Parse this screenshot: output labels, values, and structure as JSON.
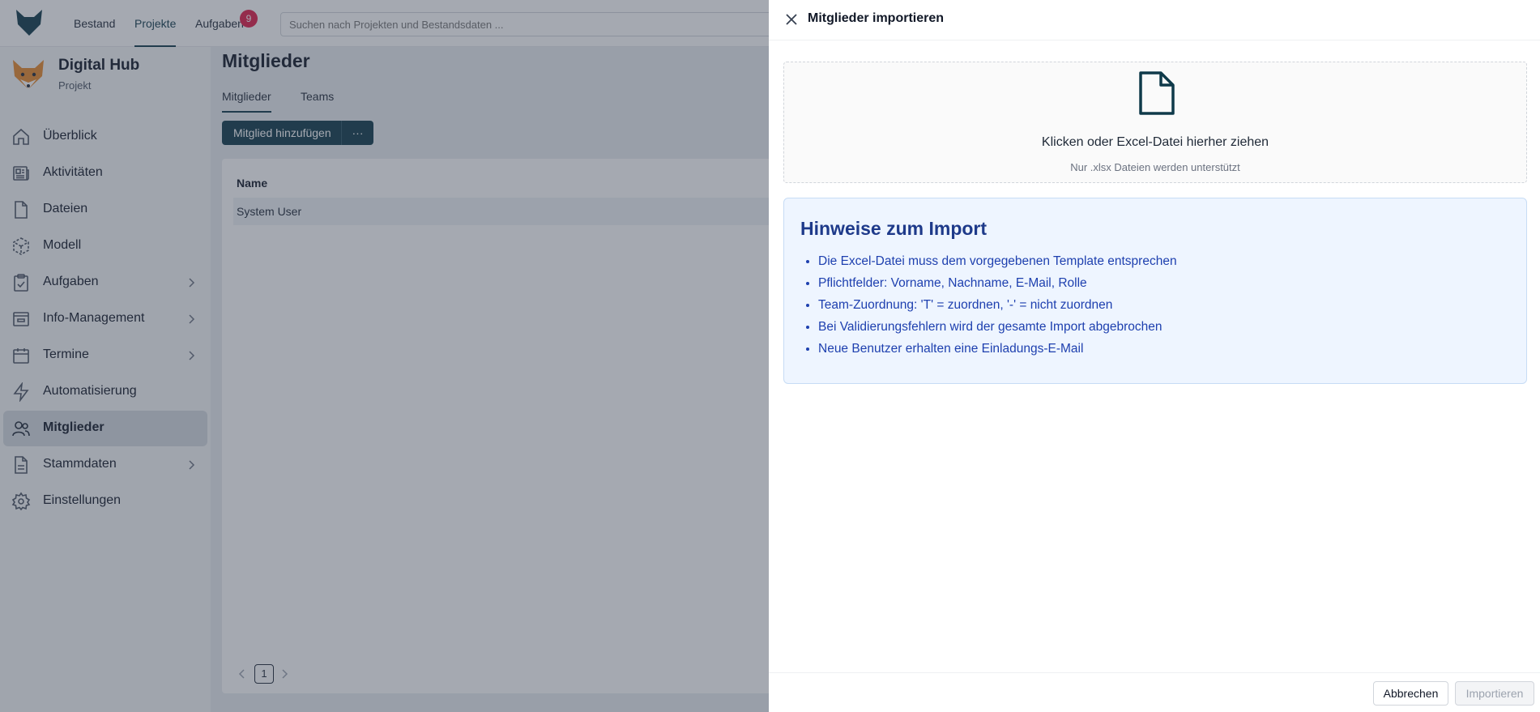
{
  "topnav": {
    "items": [
      {
        "label": "Bestand"
      },
      {
        "label": "Projekte"
      },
      {
        "label": "Aufgaben"
      }
    ],
    "tasks_badge": "9",
    "search_placeholder": "Suchen nach Projekten und Bestandsdaten ..."
  },
  "project": {
    "title": "Digital Hub",
    "subtitle": "Projekt"
  },
  "sidebar": {
    "items": [
      {
        "label": "Überblick",
        "icon": "home-icon"
      },
      {
        "label": "Aktivitäten",
        "icon": "newspaper-icon"
      },
      {
        "label": "Dateien",
        "icon": "file-icon"
      },
      {
        "label": "Modell",
        "icon": "cube-icon"
      },
      {
        "label": "Aufgaben",
        "icon": "clipboard-check-icon"
      },
      {
        "label": "Info-Management",
        "icon": "inbox-icon"
      },
      {
        "label": "Termine",
        "icon": "calendar-icon"
      },
      {
        "label": "Automatisierung",
        "icon": "lightning-icon"
      },
      {
        "label": "Mitglieder",
        "icon": "users-icon"
      },
      {
        "label": "Stammdaten",
        "icon": "document-icon"
      },
      {
        "label": "Einstellungen",
        "icon": "gear-icon"
      }
    ]
  },
  "main": {
    "title": "Mitglieder",
    "tabs": [
      {
        "label": "Mitglieder"
      },
      {
        "label": "Teams"
      }
    ],
    "add_button": "Mitglied hinzufügen",
    "more_button": "···",
    "table": {
      "columns": [
        "Name"
      ],
      "rows": [
        [
          "System User"
        ]
      ]
    },
    "pagination": {
      "current": "1"
    }
  },
  "drawer": {
    "title": "Mitglieder importieren",
    "dropzone": {
      "main_text": "Klicken oder Excel-Datei hierher ziehen",
      "sub_text": "Nur .xlsx Dateien werden unterstützt"
    },
    "info": {
      "title": "Hinweise zum Import",
      "items": [
        "Die Excel-Datei muss dem vorgegebenen Template entsprechen",
        "Pflichtfelder: Vorname, Nachname, E-Mail, Rolle",
        "Team-Zuordnung: 'T' = zuordnen, '-' = nicht zuordnen",
        "Bei Validierungsfehlern wird der gesamte Import abgebrochen",
        "Neue Benutzer erhalten eine Einladungs-E-Mail"
      ]
    },
    "cancel_button": "Abbrechen",
    "import_button": "Importieren"
  },
  "colors": {
    "primary": "#0f3a4a",
    "badge": "#e11d48",
    "info_bg": "#eef5ff",
    "info_text": "#1e40af"
  }
}
